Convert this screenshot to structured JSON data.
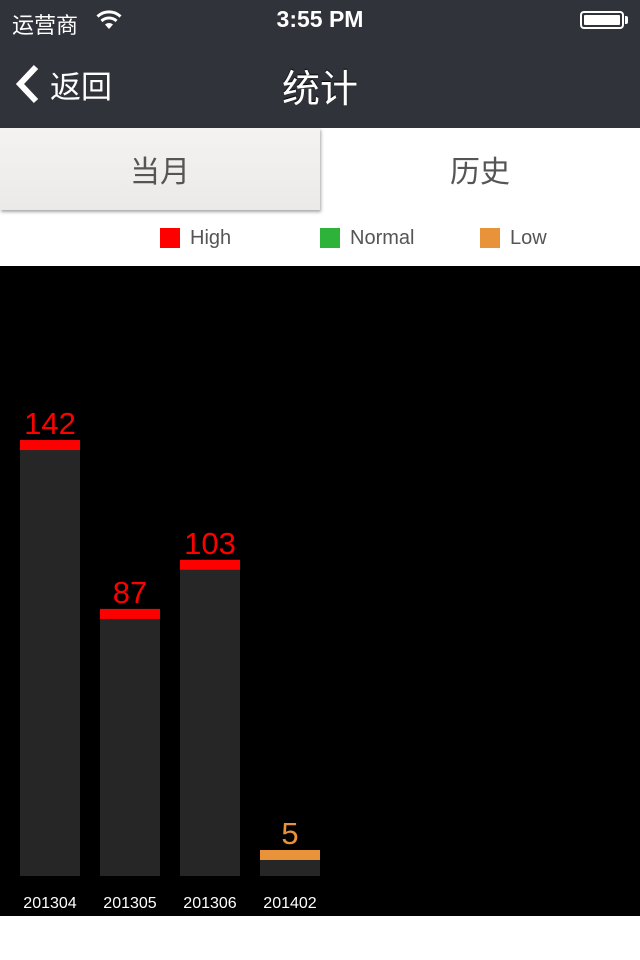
{
  "status_bar": {
    "carrier": "运营商",
    "time": "3:55 PM"
  },
  "nav": {
    "back_label": "返回",
    "title": "统计"
  },
  "tabs": [
    {
      "label": "当月",
      "active": true
    },
    {
      "label": "历史",
      "active": false
    }
  ],
  "legend": [
    {
      "label": "High",
      "color": "#ff0000"
    },
    {
      "label": "Normal",
      "color": "#2db33a"
    },
    {
      "label": "Low",
      "color": "#e8923a"
    }
  ],
  "chart_data": {
    "type": "bar",
    "title": "",
    "xlabel": "",
    "ylabel": "",
    "categories": [
      "201304",
      "201305",
      "201306",
      "201402"
    ],
    "values": [
      142,
      87,
      103,
      5
    ],
    "levels": [
      "High",
      "High",
      "High",
      "Low"
    ],
    "level_colors": {
      "High": "#ff0000",
      "Normal": "#2db33a",
      "Low": "#e8923a"
    },
    "bar_color": "#262626",
    "background": "#000000",
    "grid": false,
    "legend_position": "top"
  }
}
